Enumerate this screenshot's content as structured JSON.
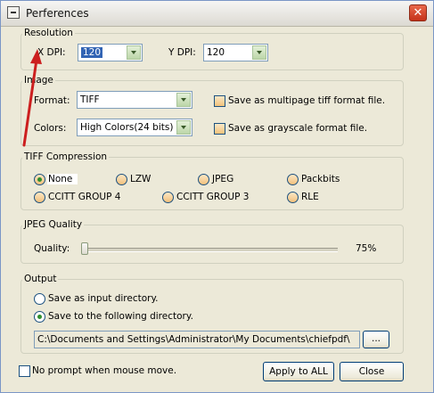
{
  "window": {
    "title": "Perferences",
    "close_glyph": "✕"
  },
  "resolution": {
    "legend": "Resolution",
    "x_dpi_label": "X DPI:",
    "x_dpi_value": "120",
    "y_dpi_label": "Y DPI:",
    "y_dpi_value": "120"
  },
  "image": {
    "legend": "Image",
    "format_label": "Format:",
    "format_value": "TIFF",
    "colors_label": "Colors:",
    "colors_value": "High Colors(24 bits)",
    "multipage_label": "Save as multipage tiff format file.",
    "grayscale_label": "Save as grayscale format file."
  },
  "tiff_compression": {
    "legend": "TIFF Compression",
    "options": [
      "None",
      "LZW",
      "JPEG",
      "Packbits",
      "CCITT GROUP 4",
      "CCITT GROUP 3",
      "RLE"
    ],
    "selected": "None"
  },
  "jpeg_quality": {
    "legend": "JPEG Quality",
    "quality_label": "Quality:",
    "value_text": "75%",
    "value": 75
  },
  "output": {
    "legend": "Output",
    "option_input_dir": "Save as input directory.",
    "option_following_dir": "Save to the following directory.",
    "selected": "following",
    "path": "C:\\Documents and Settings\\Administrator\\My Documents\\chiefpdf\\",
    "browse_label": "..."
  },
  "footer": {
    "no_prompt_label": "No prompt when mouse move.",
    "apply_all_label": "Apply to ALL",
    "close_label": "Close"
  },
  "colors": {
    "annotation_arrow": "#cc1f1f",
    "selection": "#3264b4"
  }
}
